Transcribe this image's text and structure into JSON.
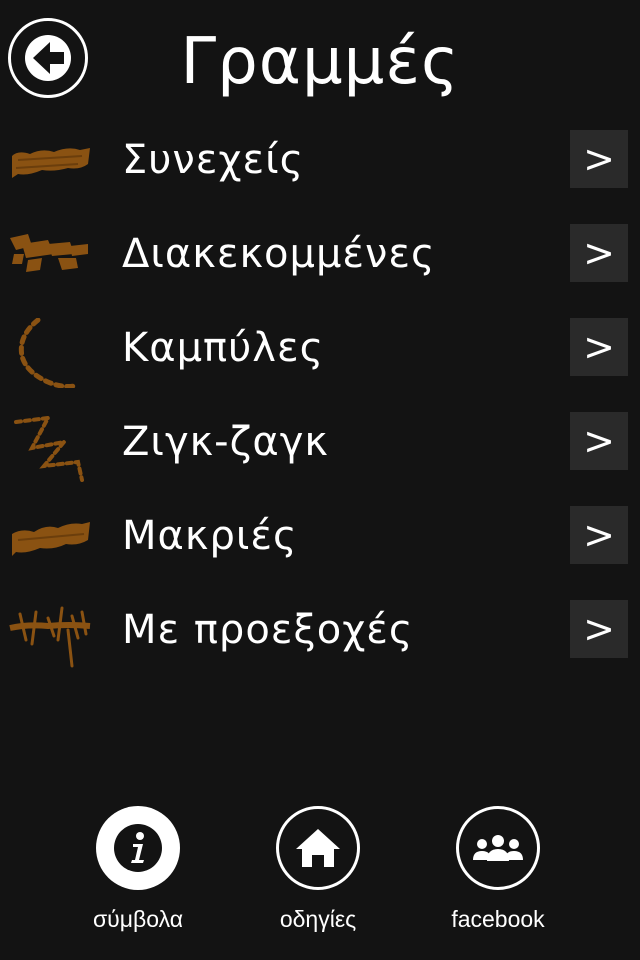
{
  "header": {
    "title": "Γραμμές",
    "back_icon": "arrow-left-icon"
  },
  "list": {
    "arrow_label": ">",
    "items": [
      {
        "label": "Συνεχείς",
        "icon": "solid-line-thumbnail"
      },
      {
        "label": "Διακεκομμένες",
        "icon": "dashed-line-thumbnail"
      },
      {
        "label": "Καμπύλες",
        "icon": "curved-line-thumbnail"
      },
      {
        "label": "Ζιγκ-ζαγκ",
        "icon": "zigzag-line-thumbnail"
      },
      {
        "label": "Μακριές",
        "icon": "long-line-thumbnail"
      },
      {
        "label": "Με προεξοχές",
        "icon": "protrusions-line-thumbnail"
      }
    ]
  },
  "tabbar": {
    "tabs": [
      {
        "label": "σύμβολα",
        "icon": "info-icon",
        "active": true
      },
      {
        "label": "οδηγίες",
        "icon": "home-icon",
        "active": false
      },
      {
        "label": "facebook",
        "icon": "group-icon",
        "active": false
      }
    ]
  },
  "colors": {
    "background": "#131313",
    "text": "#ffffff",
    "arrow_button_bg": "#2a2a2a",
    "thumbnail_brown": "#8a5212"
  }
}
